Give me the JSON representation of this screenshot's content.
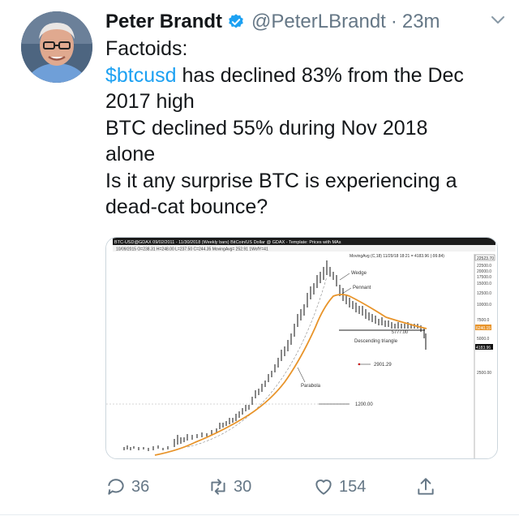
{
  "tweet": {
    "name": "Peter Brandt",
    "handle": "@PeterLBrandt",
    "separator": "·",
    "time": "23m",
    "line1": "Factoids:",
    "cashtag": "$btcusd",
    "line2_rest": " has declined 83% from the Dec",
    "line3": "2017 high",
    "line4": "BTC declined 55% during Nov 2018",
    "line5": "alone",
    "line6": "Is it any surprise BTC is experiencing a",
    "line7": "dead-cat bounce?"
  },
  "chart_image": {
    "header_line1": "BTC-USD@GDAX  09/02/2011 - 11/30/2018 (Weekly bars)  BitCoin/US Dollar @ GDAX  -  Template: Prices with MAs",
    "header_line2": "10/09/2015  O=238.31  H=248.00  L=237.50  C=244.35  MovingAvg= 252.91  1WofY=41",
    "header_line3": "MovingAvg (C,18)  11/29/18 18:21 = 4183.96 (-99.84)",
    "price_labels": [
      "22500.0",
      "20000.0",
      "17500.0",
      "15000.0",
      "12500.0",
      "10000.0",
      "7500.0",
      "5000.0",
      "2500.00"
    ],
    "top_tag": "22523.70",
    "mid_tag": "6240.15",
    "last_tag": "4183.96",
    "annotations": {
      "wedge": "Wedge",
      "pennant": "Pennant",
      "descending": "Descending triangle",
      "level_5777": "5777.00",
      "level_2901": "2901.29",
      "parabola": "Parabola",
      "level_1200": "1200.00"
    }
  },
  "actions": {
    "replies": "36",
    "retweets": "30",
    "likes": "154"
  },
  "colors": {
    "text": "#14171a",
    "muted": "#657786",
    "link": "#1da1f2",
    "verified": "#1da1f2",
    "ma_line": "#e8942a"
  },
  "icons": [
    "verified-icon",
    "chevron-down-icon",
    "reply-icon",
    "retweet-icon",
    "like-icon",
    "share-icon"
  ]
}
